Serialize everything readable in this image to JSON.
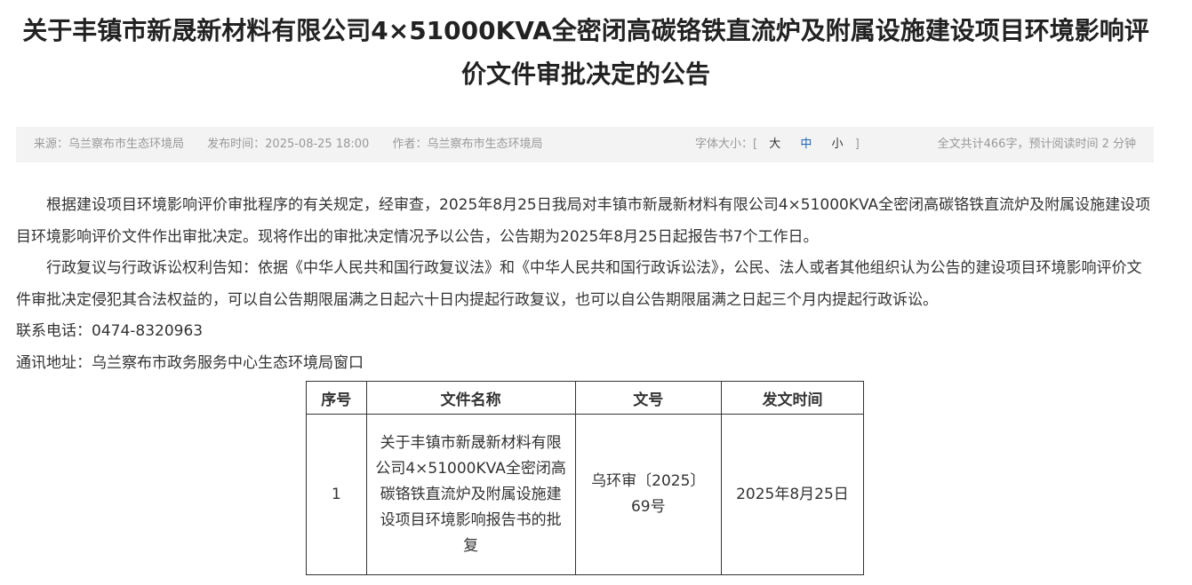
{
  "article": {
    "title": "关于丰镇市新晟新材料有限公司4×51000KVA全密闭高碳铬铁直流炉及附属设施建设项目环境影响评价文件审批决定的公告"
  },
  "meta": {
    "source": "来源：乌兰察布市生态环境局",
    "publish_time": "发布时间：2025-08-25 18:00",
    "author": "作者：乌兰察布市生态环境局",
    "font_size_label": "字体大小：[",
    "font_large": "大",
    "font_medium": "中",
    "font_small": "小",
    "font_close_bracket": "]",
    "reading_info": "全文共计466字，预计阅读时间 2 分钟"
  },
  "content": {
    "para1": "根据建设项目环境影响评价审批程序的有关规定，经审查，2025年8月25日我局对丰镇市新晟新材料有限公司4×51000KVA全密闭高碳铬铁直流炉及附属设施建设项目环境影响评价文件作出审批决定。现将作出的审批决定情况予以公告，公告期为2025年8月25日起报告书7个工作日。",
    "para2": "行政复议与行政诉讼权利告知：依据《中华人民共和国行政复议法》和《中华人民共和国行政诉讼法》，公民、法人或者其他组织认为公告的建设项目环境影响评价文件审批决定侵犯其合法权益的，可以自公告期限届满之日起六十日内提起行政复议，也可以自公告期限届满之日起三个月内提起行政诉讼。",
    "phone": "联系电话：0474-8320963",
    "address": "通讯地址：乌兰察布市政务服务中心生态环境局窗口"
  },
  "table": {
    "headers": [
      "序号",
      "文件名称",
      "文号",
      "发文时间"
    ],
    "rows": [
      [
        "1",
        "关于丰镇市新晟新材料有限公司4×51000KVA全密闭高碳铬铁直流炉及附属设施建设项目环境影响报告书的批复",
        "乌环审〔2025〕69号",
        "2025年8月25日"
      ]
    ]
  },
  "colors": {
    "active_font_size": "#1a64b4",
    "meta_bar_bg": "#f3f3f3"
  }
}
